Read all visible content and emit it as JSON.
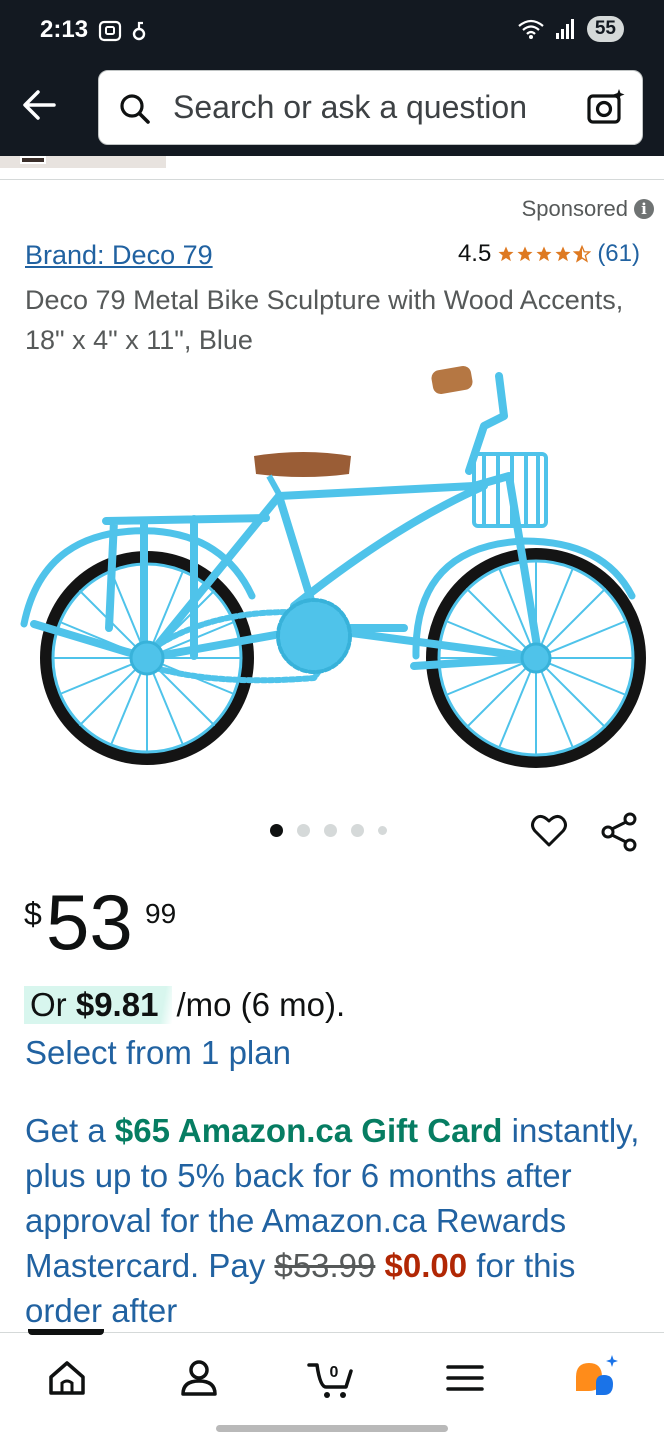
{
  "status_bar": {
    "time": "2:13",
    "battery": "55",
    "icons_left": [
      "screenshot-icon",
      "alarm-icon"
    ],
    "icons_right": [
      "wifi-icon",
      "signal-icon"
    ]
  },
  "search": {
    "placeholder": "Search or ask a question"
  },
  "product": {
    "sponsored_label": "Sponsored",
    "brand": "Brand: Deco 79",
    "rating_value": "4.5",
    "rating_stars": 4.5,
    "rating_count": "(61)",
    "title": "Deco 79 Metal Bike Sculpture with Wood Accents, 18\" x 4\" x 11\", Blue",
    "image_count": 5,
    "image_index": 1
  },
  "price": {
    "symbol": "$",
    "whole": "53",
    "fraction": "99"
  },
  "installment": {
    "prefix": "Or",
    "amount": "$9.81",
    "suffix": "/mo (6 mo).",
    "plan_link": "Select from 1 plan"
  },
  "promo": {
    "text1": "Get a ",
    "highlight": "$65 Amazon.ca Gift Card",
    "text2": " instantly, plus up to 5% back for 6 months after approval for the Amazon.ca Rewards Mastercard. Pay ",
    "old_price": "$53.99",
    "new_price": "$0.00",
    "text3": " for this order after"
  },
  "colors": {
    "header_bg": "#131921",
    "link": "#2162a1",
    "green": "#067d62",
    "red": "#b12704",
    "star": "#de7921",
    "rufus": "#ff8c1a"
  },
  "bottom_nav": [
    "home-icon",
    "account-icon",
    "cart-icon",
    "menu-icon",
    "rufus-icon"
  ],
  "cart_count": "0"
}
